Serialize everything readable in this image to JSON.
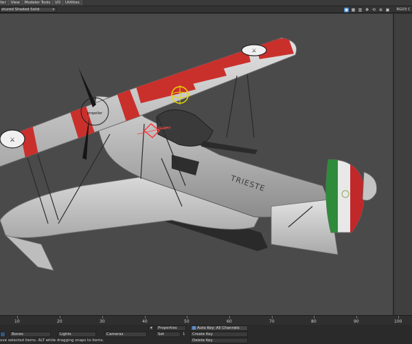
{
  "menubar": {
    "items": [
      "ller",
      "View",
      "Modeler Tools",
      "I/O",
      "Utilities"
    ]
  },
  "viewbar": {
    "mode": "xtured Shaded Solid",
    "right_label": "RG03 C",
    "icons": [
      "camera-icon",
      "grid-icon",
      "layer-icon",
      "move-view-icon",
      "rotate-view-icon",
      "zoom-view-icon",
      "maximize-icon"
    ]
  },
  "scene": {
    "fuselage_text": "TRIESTE",
    "propeller_label": "propeller",
    "cockpit_label": "COCKPIT",
    "colors": {
      "background": "#4a4a4a",
      "wing": "#cfcfcf",
      "stripe": "#c9302c",
      "tail_green": "#2e8b3a",
      "tail_red": "#c0282a"
    }
  },
  "timeline": {
    "ticks": [
      "10",
      "20",
      "30",
      "40",
      "50",
      "60",
      "70",
      "80",
      "90",
      "100"
    ]
  },
  "bottom": {
    "bones": "Bones",
    "lights": "Lights",
    "cameras": "Cameras",
    "properties": "Properties",
    "set": "Set",
    "set_value": "1",
    "auto_key": "Auto Key: All Channels",
    "create_key": "Create Key",
    "delete_key": "Delete Key",
    "status": "ove selected items. ALT while dragging snaps to items."
  }
}
